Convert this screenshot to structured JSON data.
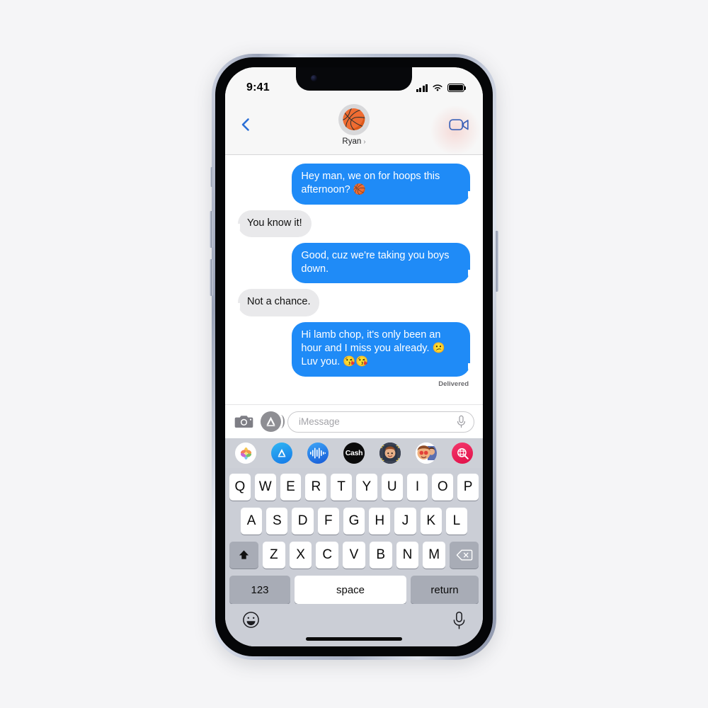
{
  "device": {
    "name": "iphone-13-pro",
    "side_buttons": [
      "mute-switch",
      "volume-up",
      "volume-down",
      "power"
    ]
  },
  "status_bar": {
    "time": "9:41",
    "cellular_icon": "signal-bars-icon",
    "wifi_icon": "wifi-icon",
    "battery_icon": "battery-full-icon"
  },
  "nav": {
    "back_icon": "chevron-left-icon",
    "contact_name": "Ryan",
    "contact_chevron": "›",
    "avatar_emoji": "🏀",
    "facetime_icon": "video-camera-icon"
  },
  "conversation": {
    "messages": [
      {
        "side": "out",
        "text": "Hey man, we on for hoops this afternoon? 🏀"
      },
      {
        "side": "in",
        "text": "You know it!"
      },
      {
        "side": "out",
        "text": "Good, cuz we're taking you boys down."
      },
      {
        "side": "in",
        "text": "Not a chance."
      },
      {
        "side": "out",
        "text": "Hi lamb chop, it's only been an hour and I miss you already. 😕 Luv you. 😘😘"
      }
    ],
    "delivered_label": "Delivered",
    "bubble_out_color": "#1f8bf7",
    "bubble_in_color": "#e9e9eb"
  },
  "input_bar": {
    "camera_icon": "camera-icon",
    "appstore_icon": "app-store-icon",
    "placeholder": "iMessage",
    "mic_icon": "microphone-icon"
  },
  "app_drawer": {
    "apps": [
      {
        "name": "photos",
        "label": ""
      },
      {
        "name": "app-store",
        "label": ""
      },
      {
        "name": "digital-touch",
        "label": ""
      },
      {
        "name": "apple-cash",
        "label": "Cash"
      },
      {
        "name": "memoji",
        "label": ""
      },
      {
        "name": "memoji-stickers",
        "label": ""
      },
      {
        "name": "images-gif",
        "label": ""
      }
    ]
  },
  "keyboard": {
    "row1": [
      "Q",
      "W",
      "E",
      "R",
      "T",
      "Y",
      "U",
      "I",
      "O",
      "P"
    ],
    "row2": [
      "A",
      "S",
      "D",
      "F",
      "G",
      "H",
      "J",
      "K",
      "L"
    ],
    "row3": [
      "Z",
      "X",
      "C",
      "V",
      "B",
      "N",
      "M"
    ],
    "shift_icon": "shift-up-arrow-icon",
    "delete_icon": "backspace-delete-icon",
    "numbers_label": "123",
    "space_label": "space",
    "return_label": "return",
    "emoji_icon": "smiley-face-icon",
    "dictation_icon": "microphone-icon"
  }
}
